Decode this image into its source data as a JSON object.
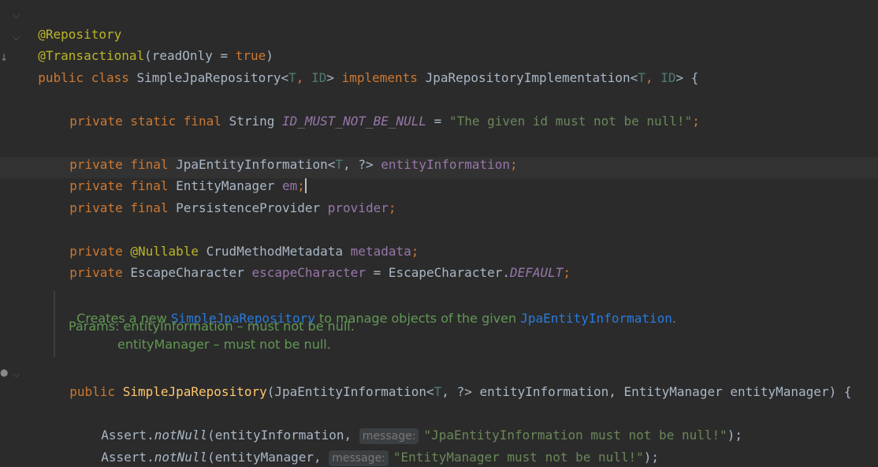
{
  "lines": {
    "l1": {
      "ann": "@Repository"
    },
    "l2": {
      "ann": "@Transactional",
      "p1": "(readOnly = ",
      "kw": "true",
      "p2": ")"
    },
    "l3": {
      "kw1": "public class ",
      "n1": "SimpleJpaRepository<",
      "t1": "T",
      "c1": ", ",
      "t2": "ID",
      "n2": "> ",
      "kw2": "implements ",
      "n3": "JpaRepositoryImplementation<",
      "t3": "T",
      "c2": ", ",
      "t4": "ID",
      "n4": "> {"
    },
    "l4": {
      "kw": "private static final ",
      "type": "String ",
      "const": "ID_MUST_NOT_BE_NULL",
      "eq": " = ",
      "str": "\"The given id must not be null!\"",
      "semi": ";"
    },
    "l5": {
      "kw": "private final ",
      "type": "JpaEntityInformation<",
      "t": "T",
      "rest": ", ?> ",
      "fld": "entityInformation",
      "semi": ";"
    },
    "l6": {
      "kw": "private final ",
      "type": "EntityManager ",
      "fld": "em",
      "semi": ";"
    },
    "l7": {
      "kw": "private final ",
      "type": "PersistenceProvider ",
      "fld": "provider",
      "semi": ";"
    },
    "l8": {
      "kw": "private ",
      "ann": "@Nullable ",
      "type": "CrudMethodMetadata ",
      "fld": "metadata",
      "semi": ";"
    },
    "l9": {
      "kw": "private ",
      "type": "EscapeCharacter ",
      "fld": "escapeCharacter",
      "eq": " = EscapeCharacter.",
      "const": "DEFAULT",
      "semi": ";"
    },
    "l10": {
      "kw": "public ",
      "mth": "SimpleJpaRepository",
      "p1": "(JpaEntityInformation<",
      "t": "T",
      "p2": ", ?> entityInformation, EntityManager entityManager) {"
    },
    "l11": {
      "cls": "Assert.",
      "mth": "notNull",
      "p1": "(entityInformation, ",
      "hint": "message:",
      "str": "\"JpaEntityInformation must not be null!\"",
      "end": ");"
    },
    "l12": {
      "cls": "Assert.",
      "mth": "notNull",
      "p1": "(entityManager, ",
      "hint": "message:",
      "str": "\"EntityManager must not be null!\"",
      "end": ");"
    }
  },
  "doc": {
    "d1a": "Creates a new ",
    "d1link1": "SimpleJpaRepository",
    "d1b": " to manage objects of the given ",
    "d1link2": "JpaEntityInformation",
    "d1c": ".",
    "d2": "Params: entityInformation – must not be null.",
    "d3": "entityManager – must not be null."
  }
}
